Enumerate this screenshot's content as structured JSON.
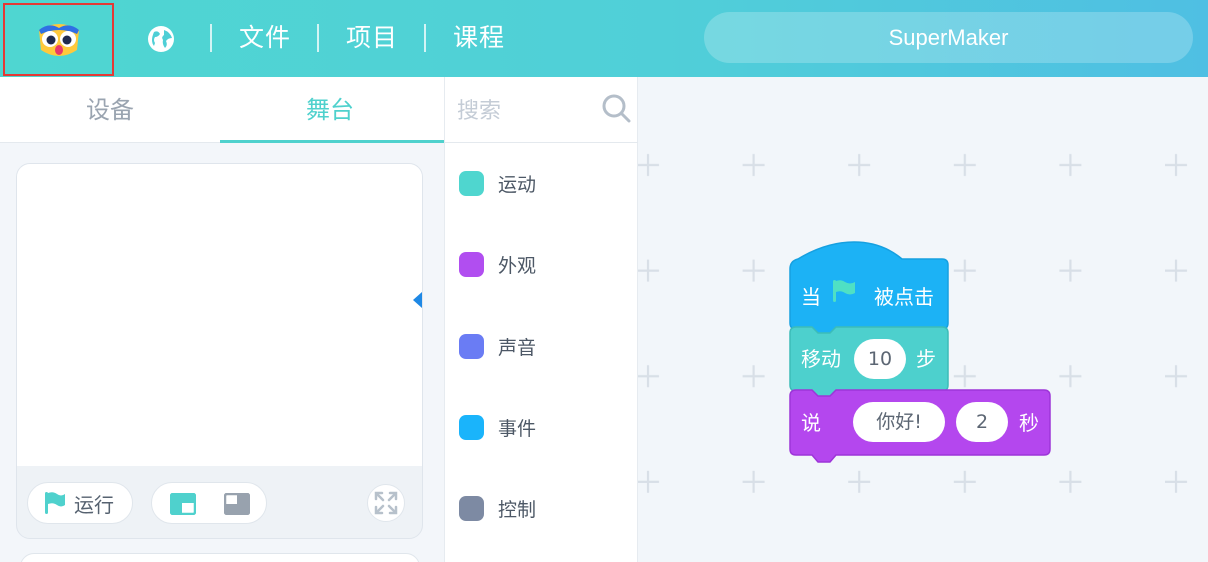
{
  "header": {
    "menu": [
      "文件",
      "项目",
      "课程"
    ],
    "user": "SuperMaker"
  },
  "left_panel": {
    "tabs": [
      "设备",
      "舞台"
    ],
    "active_tab": "舞台",
    "run_label": "运行"
  },
  "categories": {
    "search_placeholder": "搜索",
    "items": [
      {
        "label": "运动",
        "color": "#4fd6cf"
      },
      {
        "label": "外观",
        "color": "#b14ef0"
      },
      {
        "label": "声音",
        "color": "#6a7cf4"
      },
      {
        "label": "事件",
        "color": "#1ab4fb"
      },
      {
        "label": "控制",
        "color": "#7d8aa3"
      }
    ]
  },
  "blocks": {
    "hat": {
      "prefix": "当",
      "suffix": "被点击",
      "color": "#1cb2f5"
    },
    "move": {
      "label": "移动",
      "value": "10",
      "unit": "步",
      "color": "#4dd0cd"
    },
    "say": {
      "label": "说",
      "text": "你好!",
      "seconds": "2",
      "unit": "秒",
      "color": "#b447ee"
    }
  }
}
